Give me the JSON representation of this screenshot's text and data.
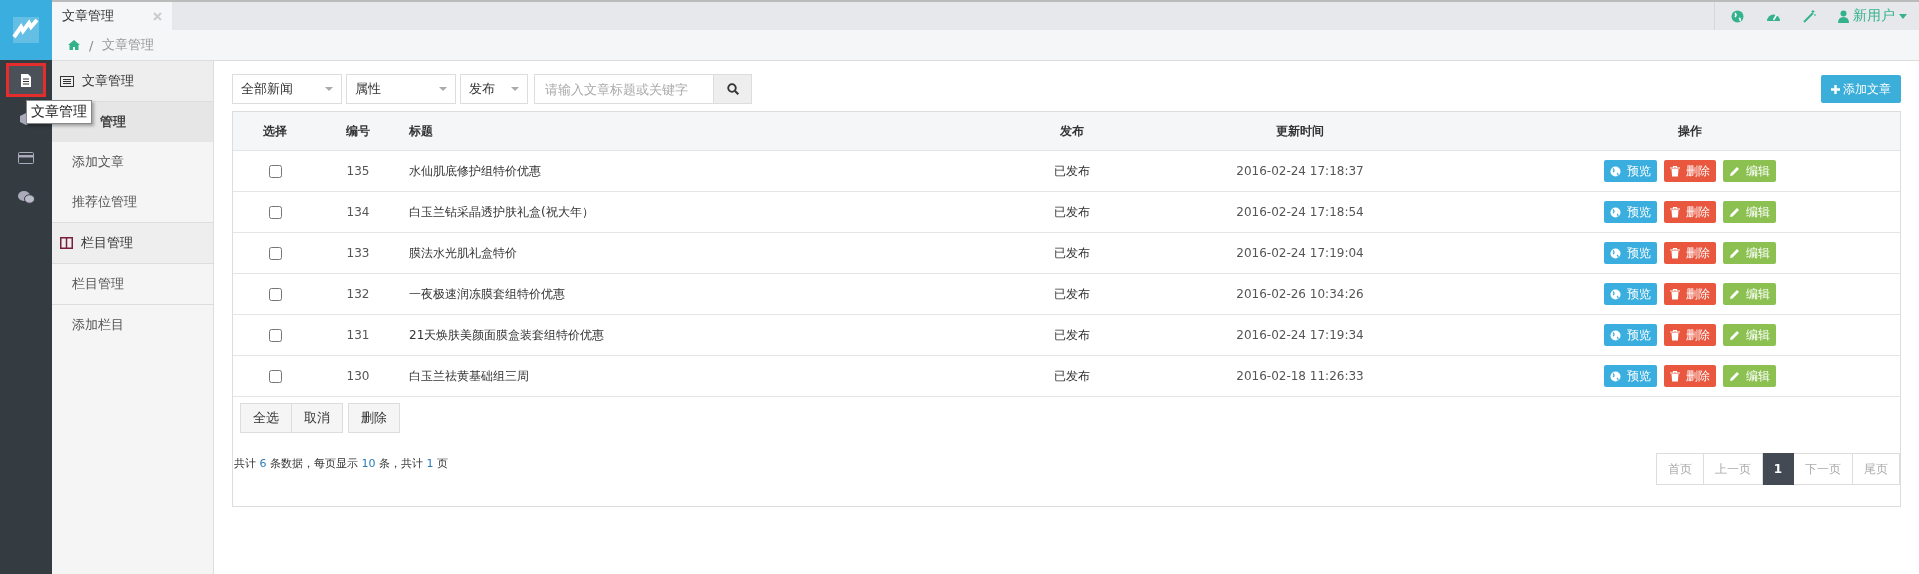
{
  "sidebar_icons": [
    {
      "kind": "document",
      "selected": true
    },
    {
      "kind": "cube",
      "selected": false
    },
    {
      "kind": "card",
      "selected": false
    },
    {
      "kind": "chat",
      "selected": false
    }
  ],
  "tooltip": "文章管理",
  "tabs": [
    {
      "label": "文章管理",
      "selected": true
    }
  ],
  "breadcrumb": {
    "separator": "/",
    "current": "文章管理"
  },
  "user_menu": {
    "name": "新用户"
  },
  "menu_groups": [
    {
      "title": "文章管理",
      "items": [
        {
          "label": "管理",
          "selected": true
        },
        {
          "label": "添加文章",
          "selected": false
        },
        {
          "label": "推荐位管理",
          "selected": false
        }
      ]
    },
    {
      "title": "栏目管理",
      "items": [
        {
          "label": "栏目管理",
          "selected": false
        },
        {
          "label": "添加栏目",
          "selected": false
        }
      ]
    }
  ],
  "filters": [
    {
      "value": "全部新闻"
    },
    {
      "value": "属性"
    },
    {
      "value": "发布"
    }
  ],
  "search": {
    "placeholder": "请输入文章标题或关键字"
  },
  "add_button": "添加文章",
  "table": {
    "columns": [
      "选择",
      "编号",
      "标题",
      "发布",
      "更新时间",
      "操作"
    ],
    "rows": [
      {
        "checked": false,
        "id": "135",
        "title": "水仙肌底修护组特价优惠",
        "status": "已发布",
        "updated": "2016-02-24 17:18:37",
        "actions": [
          {
            "kind": "preview",
            "label": "预览"
          },
          {
            "kind": "delete",
            "label": "删除"
          },
          {
            "kind": "edit",
            "label": "编辑"
          }
        ]
      },
      {
        "checked": false,
        "id": "134",
        "title": "白玉兰钻采晶透护肤礼盒(祝大年）",
        "status": "已发布",
        "updated": "2016-02-24 17:18:54",
        "actions": [
          {
            "kind": "preview",
            "label": "预览"
          },
          {
            "kind": "delete",
            "label": "删除"
          },
          {
            "kind": "edit",
            "label": "编辑"
          }
        ]
      },
      {
        "checked": false,
        "id": "133",
        "title": "膜法水光肌礼盒特价",
        "status": "已发布",
        "updated": "2016-02-24 17:19:04",
        "actions": [
          {
            "kind": "preview",
            "label": "预览"
          },
          {
            "kind": "delete",
            "label": "删除"
          },
          {
            "kind": "edit",
            "label": "编辑"
          }
        ]
      },
      {
        "checked": false,
        "id": "132",
        "title": "一夜极速润冻膜套组特价优惠",
        "status": "已发布",
        "updated": "2016-02-26 10:34:26",
        "actions": [
          {
            "kind": "preview",
            "label": "预览"
          },
          {
            "kind": "delete",
            "label": "删除"
          },
          {
            "kind": "edit",
            "label": "编辑"
          }
        ]
      },
      {
        "checked": false,
        "id": "131",
        "title": "21天焕肤美颜面膜盒装套组特价优惠",
        "status": "已发布",
        "updated": "2016-02-24 17:19:34",
        "actions": [
          {
            "kind": "preview",
            "label": "预览"
          },
          {
            "kind": "delete",
            "label": "删除"
          },
          {
            "kind": "edit",
            "label": "编辑"
          }
        ]
      },
      {
        "checked": false,
        "id": "130",
        "title": "白玉兰祛黄基础组三周",
        "status": "已发布",
        "updated": "2016-02-18 11:26:33",
        "actions": [
          {
            "kind": "preview",
            "label": "预览"
          },
          {
            "kind": "delete",
            "label": "删除"
          },
          {
            "kind": "edit",
            "label": "编辑"
          }
        ]
      }
    ]
  },
  "bulk_buttons": [
    {
      "label": "全选"
    },
    {
      "label": "取消"
    },
    {
      "label": "删除"
    }
  ],
  "summary": [
    {
      "text": "共计 ",
      "highlight": false
    },
    {
      "text": "6",
      "highlight": true
    },
    {
      "text": " 条数据，每页显示 ",
      "highlight": false
    },
    {
      "text": "10",
      "highlight": true
    },
    {
      "text": " 条，共计 ",
      "highlight": false
    },
    {
      "text": "1",
      "highlight": true
    },
    {
      "text": " 页",
      "highlight": false
    }
  ],
  "pagination": [
    {
      "label": "首页",
      "selected": false,
      "disabled": true
    },
    {
      "label": "上一页",
      "selected": false,
      "disabled": true
    },
    {
      "label": "1",
      "selected": true,
      "disabled": false
    },
    {
      "label": "下一页",
      "selected": false,
      "disabled": true
    },
    {
      "label": "尾页",
      "selected": false,
      "disabled": true
    }
  ]
}
